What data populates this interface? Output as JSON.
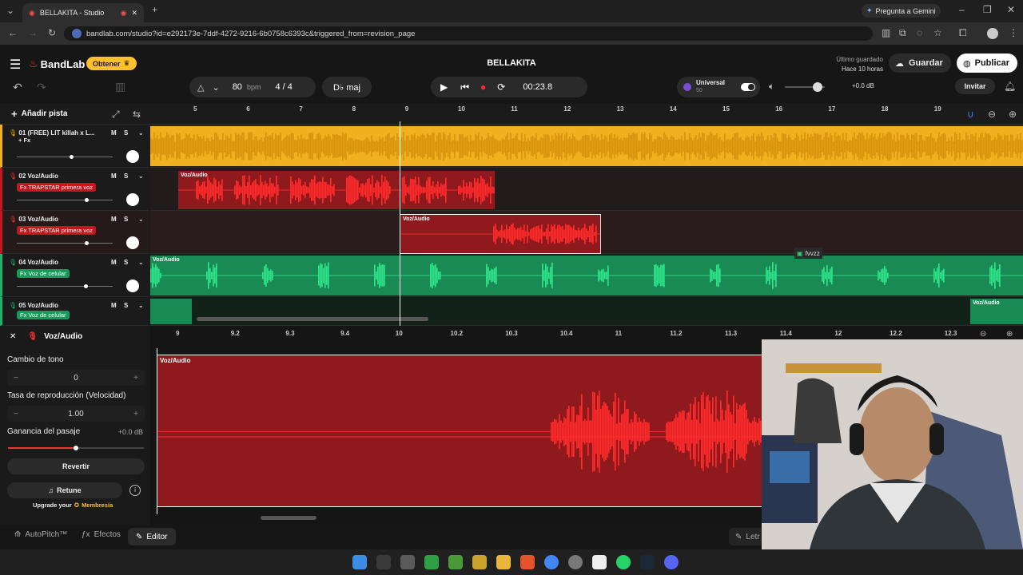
{
  "browser": {
    "tab_title": "BELLAKITA - Studio",
    "url": "bandlab.com/studio?id=e292173e-7ddf-4272-9216-6b0758c6393c&triggered_from=revision_page",
    "gemini": "Pregunta a Gemini"
  },
  "app": {
    "logo": "BandLab",
    "obtener": "Obtener",
    "project_title": "BELLAKITA",
    "saved_label": "Último guardado",
    "saved_time": "Hace 10 horas",
    "save": "Guardar",
    "publish": "Publicar",
    "invite": "Invitar"
  },
  "transport": {
    "bpm": "80",
    "bpm_unit": "bpm",
    "time_sig": "4 / 4",
    "key": "D♭ maj",
    "time": "00:23.8",
    "universal": "Universal",
    "universal_sub": "50",
    "volume": "+0.0 dB"
  },
  "tracks_header": {
    "add": "Añadir pista"
  },
  "tracks": [
    {
      "name": "01  (FREE) LIT killah x L...",
      "fx": "+ Fx",
      "m": "M",
      "s": "S"
    },
    {
      "name": "02  Voz/Audio",
      "fx": "Fx TRAPSTAR primera voz",
      "m": "M",
      "s": "S"
    },
    {
      "name": "03  Voz/Audio",
      "fx": "Fx TRAPSTAR primera voz",
      "m": "M",
      "s": "S"
    },
    {
      "name": "04  Voz/Audio",
      "fx": "Fx Voz de celular",
      "m": "M",
      "s": "S"
    },
    {
      "name": "05  Voz/Audio",
      "fx": "Fx Voz de celular",
      "m": "M",
      "s": "S"
    }
  ],
  "ruler_top": [
    "5",
    "6",
    "7",
    "8",
    "9",
    "10",
    "11",
    "12",
    "13",
    "14",
    "15",
    "16",
    "17",
    "18",
    "19"
  ],
  "ruler_bottom": [
    "9",
    "9.2",
    "9.3",
    "9.4",
    "10",
    "10.2",
    "10.3",
    "10.4",
    "11",
    "11.2",
    "11.3",
    "11.4",
    "12",
    "12.2",
    "12.3"
  ],
  "clips": {
    "voz": "Voz/Audio",
    "collab": "fvvzz"
  },
  "editor": {
    "title": "Voz/Audio",
    "pitch_label": "Cambio de tono",
    "pitch_value": "0",
    "rate_label": "Tasa de reproducción (Velocidad)",
    "rate_value": "1.00",
    "gain_label": "Ganancia del pasaje",
    "gain_value": "+0.0 dB",
    "revert": "Revertir",
    "retune": "Retune",
    "upgrade": "Upgrade your",
    "membership": "Membresía",
    "clip_label": "Voz/Audio"
  },
  "bottom": {
    "autopitch": "AutoPitch™",
    "efectos": "Efectos",
    "editor": "Editor",
    "letra": "Letr"
  },
  "colors": {
    "yellow": "#f1b01f",
    "red": "#c5161d",
    "green": "#1fb36a",
    "accent": "#ffbf2e"
  }
}
